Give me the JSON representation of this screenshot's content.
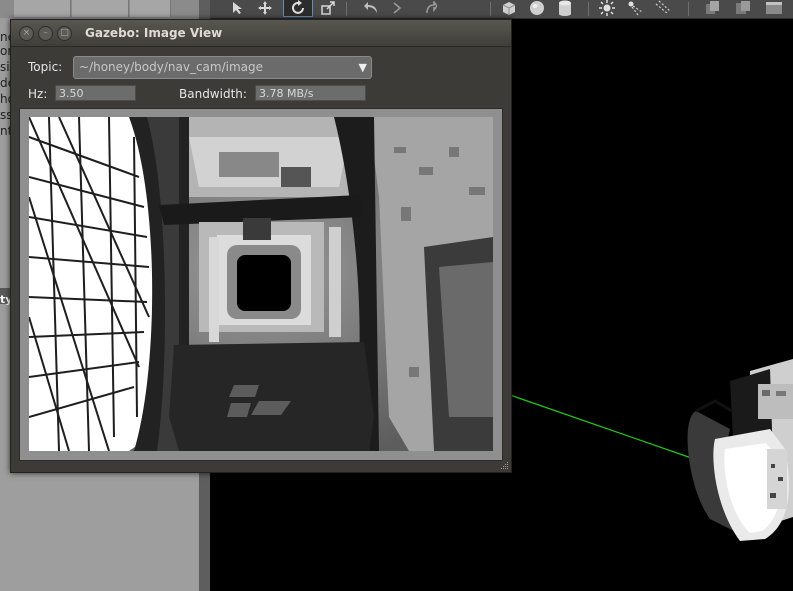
{
  "dialog": {
    "title": "Gazebo: Image View",
    "topic_label": "Topic:",
    "topic_value": "~/honey/body/nav_cam/image",
    "hz_label": "Hz:",
    "hz_value": "3.50",
    "bandwidth_label": "Bandwidth:",
    "bandwidth_value": "3.78 MB/s"
  },
  "left_panel": {
    "text_fragments": [
      "ne",
      "on",
      "si",
      "de",
      "ho",
      "ss",
      "nt"
    ],
    "selected_fragment": "ty"
  },
  "toolbar": {
    "icons": [
      "select-arrow-icon",
      "translate-icon",
      "rotate-icon",
      "scale-icon",
      "undo-icon",
      "redo-icon",
      "box-icon",
      "sphere-icon",
      "cylinder-icon",
      "sun-icon",
      "spot-light-icon",
      "dir-light-icon",
      "copy-icon",
      "paste-icon"
    ],
    "active": "rotate-icon"
  },
  "colors": {
    "dialog_bg": "#3c3b37",
    "title_bar": "#4b4a44",
    "scene_bg": "#000000",
    "axis_line": "#22c81f"
  }
}
